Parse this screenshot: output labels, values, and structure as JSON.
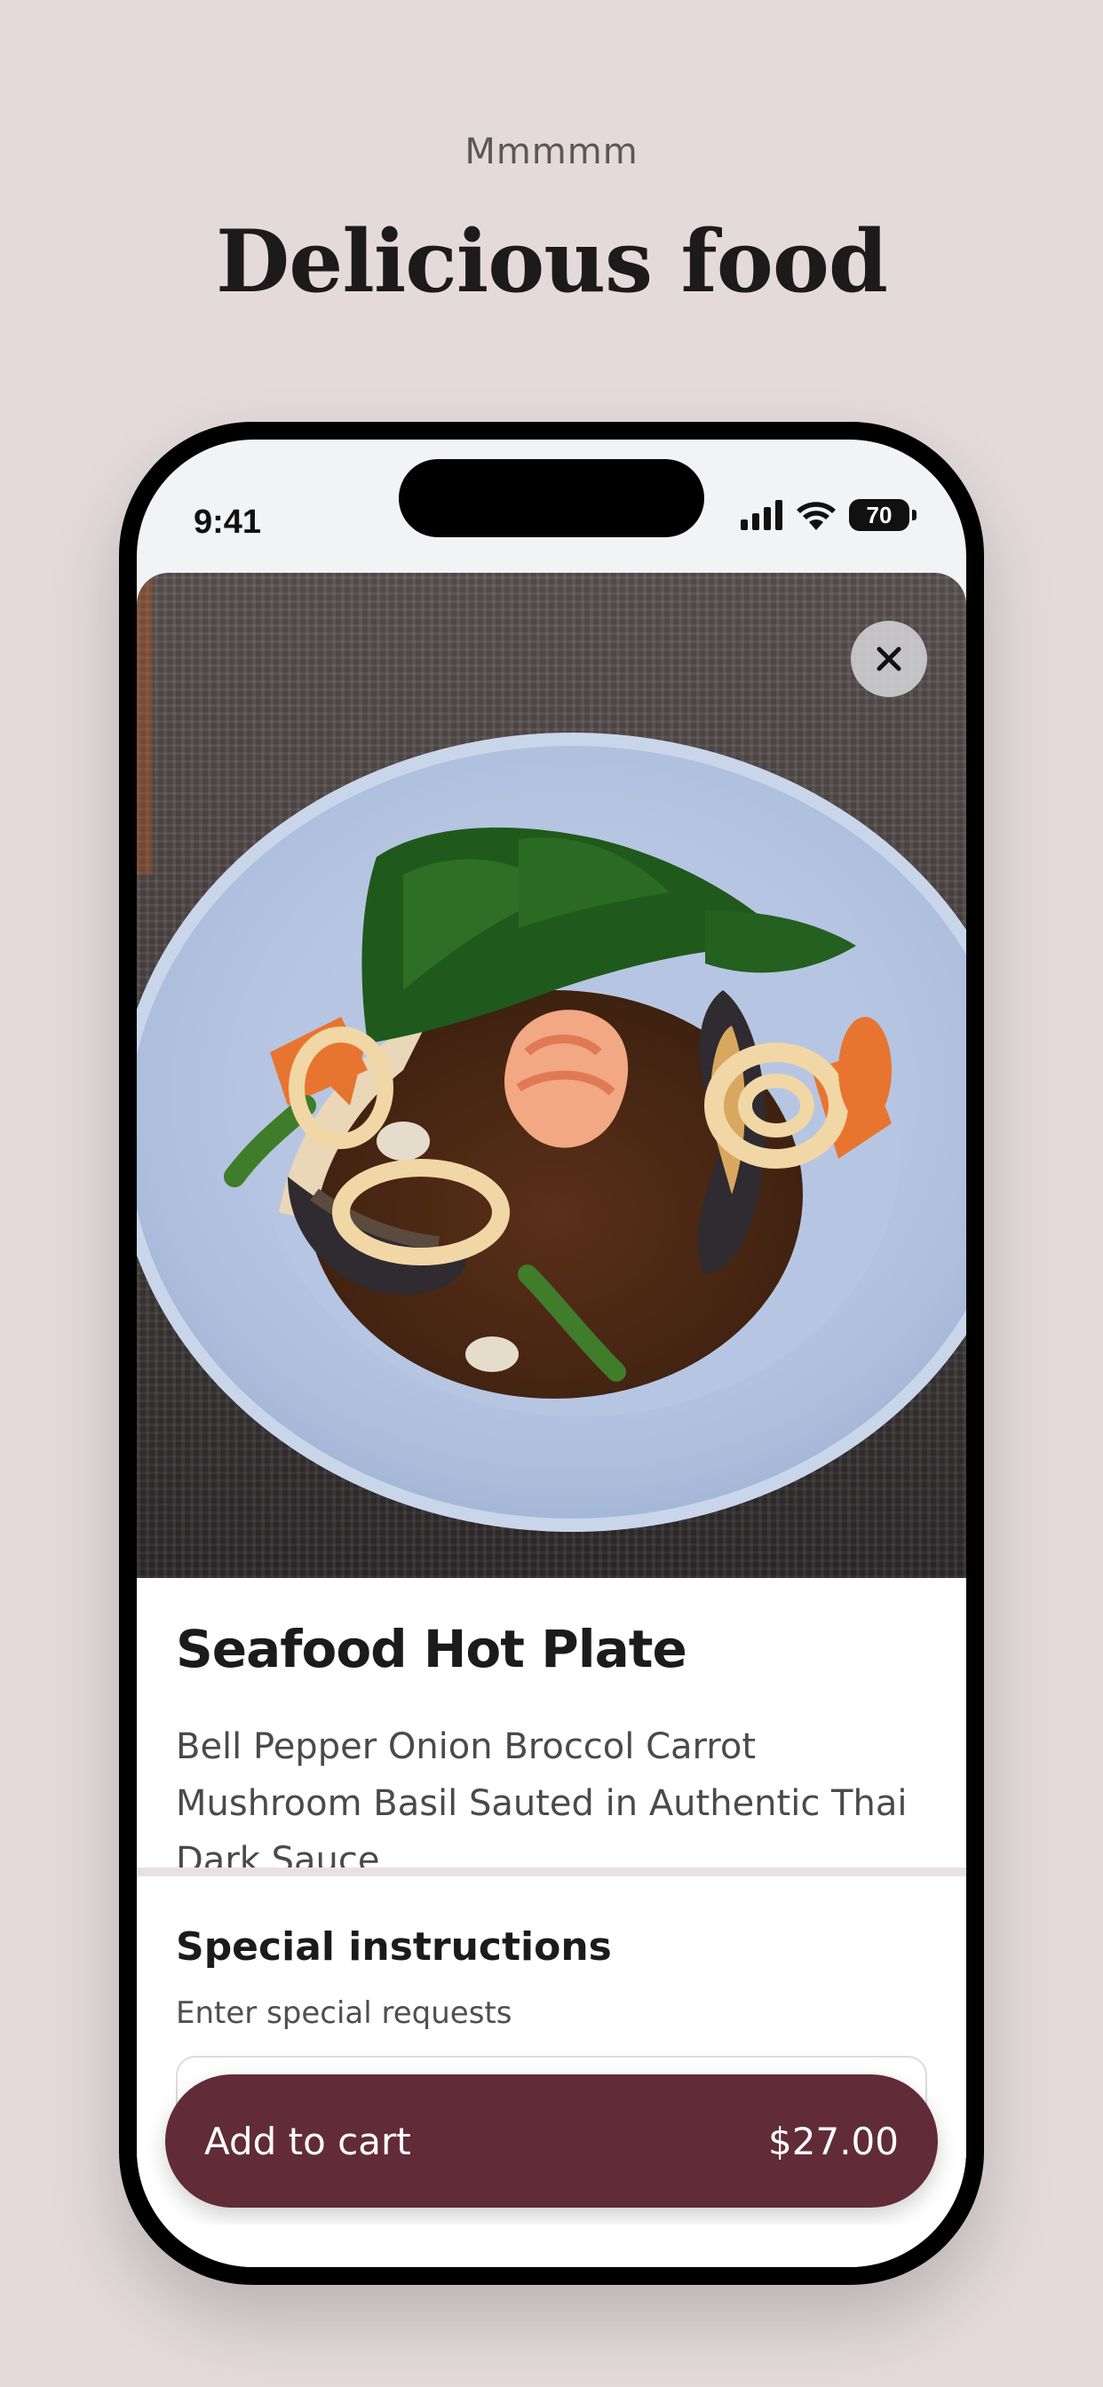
{
  "page": {
    "kicker": "Mmmmm",
    "headline": "Delicious food"
  },
  "status_bar": {
    "time": "9:41",
    "battery": "70"
  },
  "item": {
    "image_icon": "food-photo-seafood-plate",
    "title": "Seafood Hot Plate",
    "description": "Bell Pepper Onion Broccol Carrot Mushroom Basil Sauted in Authentic Thai Dark Sauce"
  },
  "special_instructions": {
    "title": "Special instructions",
    "subtitle": "Enter special requests",
    "value": ""
  },
  "cart": {
    "label": "Add to cart",
    "price": "$27.00"
  },
  "colors": {
    "background": "#e4dadc",
    "accent": "#622b38"
  }
}
